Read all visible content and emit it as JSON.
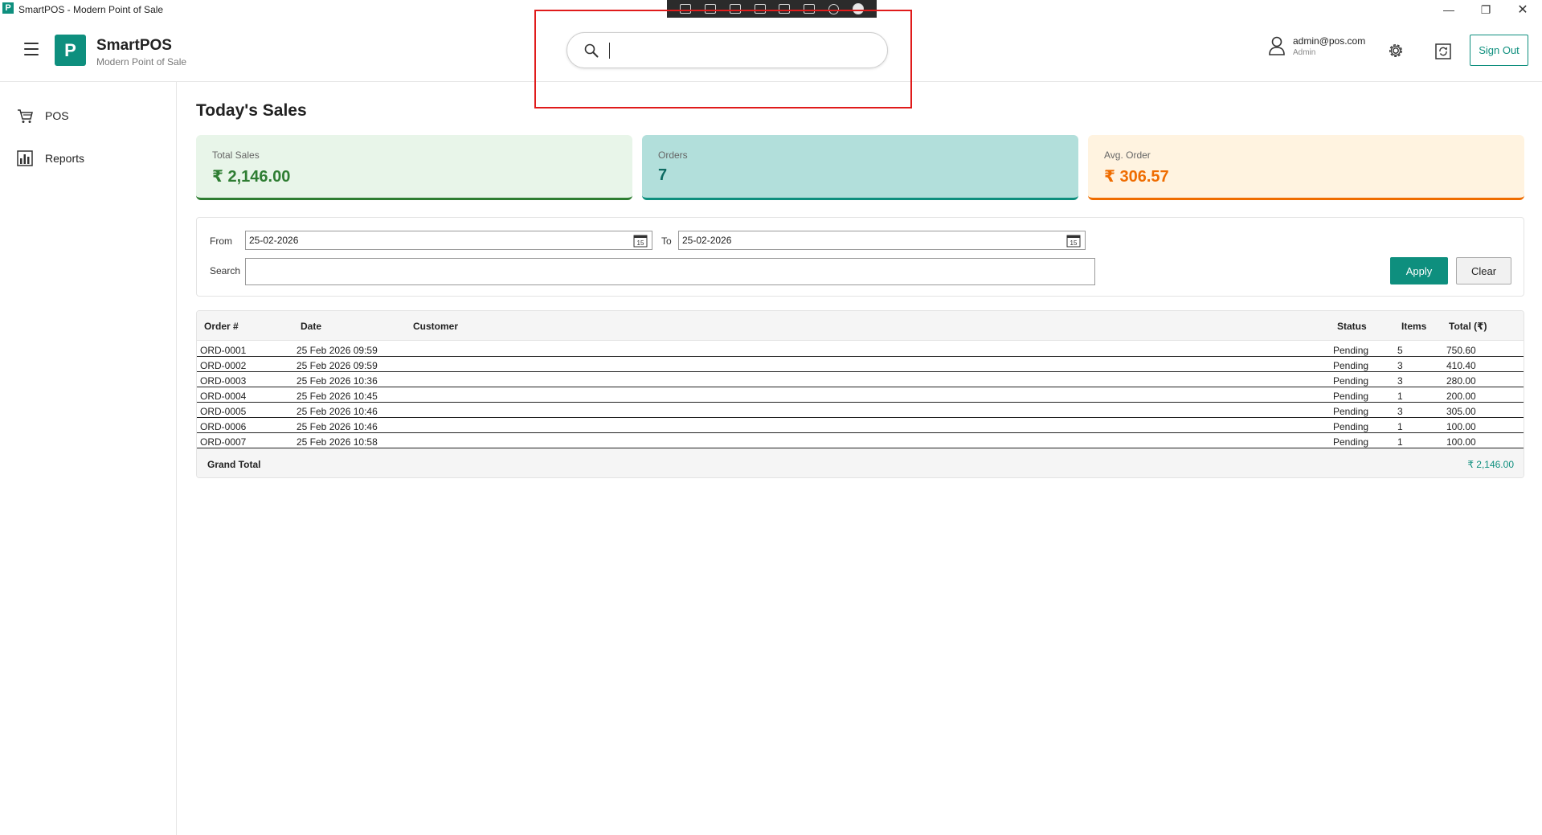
{
  "window": {
    "title": "SmartPOS - Modern Point of Sale",
    "minimize": "—",
    "maximize": "❐",
    "close": "✕"
  },
  "header": {
    "logo_letter": "P",
    "brand_name": "SmartPOS",
    "brand_sub": "Modern Point of Sale",
    "search_value": "",
    "user_email": "admin@pos.com",
    "user_role": "Admin",
    "sign_out_label": "Sign Out"
  },
  "sidebar": {
    "items": [
      {
        "label": "POS",
        "icon": "cart-icon"
      },
      {
        "label": "Reports",
        "icon": "bar-chart-icon"
      }
    ]
  },
  "page": {
    "title": "Today's Sales"
  },
  "cards": {
    "total_sales": {
      "label": "Total Sales",
      "value": "₹ 2,146.00"
    },
    "orders": {
      "label": "Orders",
      "value": "7"
    },
    "avg_order": {
      "label": "Avg. Order",
      "value": "₹ 306.57"
    }
  },
  "filters": {
    "from_label": "From",
    "from_value": "25-02-2026",
    "to_label": "To",
    "to_value": "25-02-2026",
    "search_label": "Search",
    "search_value": "",
    "apply_label": "Apply",
    "clear_label": "Clear",
    "calendar_day": "15"
  },
  "table": {
    "headers": {
      "order": "Order #",
      "date": "Date",
      "customer": "Customer",
      "status": "Status",
      "items": "Items",
      "total": "Total (₹)"
    },
    "rows": [
      {
        "order": "ORD-0001",
        "date": "25 Feb 2026 09:59",
        "customer": "",
        "status": "Pending",
        "items": "5",
        "total": "750.60"
      },
      {
        "order": "ORD-0002",
        "date": "25 Feb 2026 09:59",
        "customer": "",
        "status": "Pending",
        "items": "3",
        "total": "410.40"
      },
      {
        "order": "ORD-0003",
        "date": "25 Feb 2026 10:36",
        "customer": "",
        "status": "Pending",
        "items": "3",
        "total": "280.00"
      },
      {
        "order": "ORD-0004",
        "date": "25 Feb 2026 10:45",
        "customer": "",
        "status": "Pending",
        "items": "1",
        "total": "200.00"
      },
      {
        "order": "ORD-0005",
        "date": "25 Feb 2026 10:46",
        "customer": "",
        "status": "Pending",
        "items": "3",
        "total": "305.00"
      },
      {
        "order": "ORD-0006",
        "date": "25 Feb 2026 10:46",
        "customer": "",
        "status": "Pending",
        "items": "1",
        "total": "100.00"
      },
      {
        "order": "ORD-0007",
        "date": "25 Feb 2026 10:58",
        "customer": "",
        "status": "Pending",
        "items": "1",
        "total": "100.00"
      }
    ],
    "grand_total_label": "Grand Total",
    "grand_total_value": "₹ 2,146.00"
  },
  "colors": {
    "accent": "#0e8f7e",
    "sales_green": "#2e7d32",
    "avg_orange": "#ef6c00",
    "highlight_red": "#e01b1b"
  }
}
